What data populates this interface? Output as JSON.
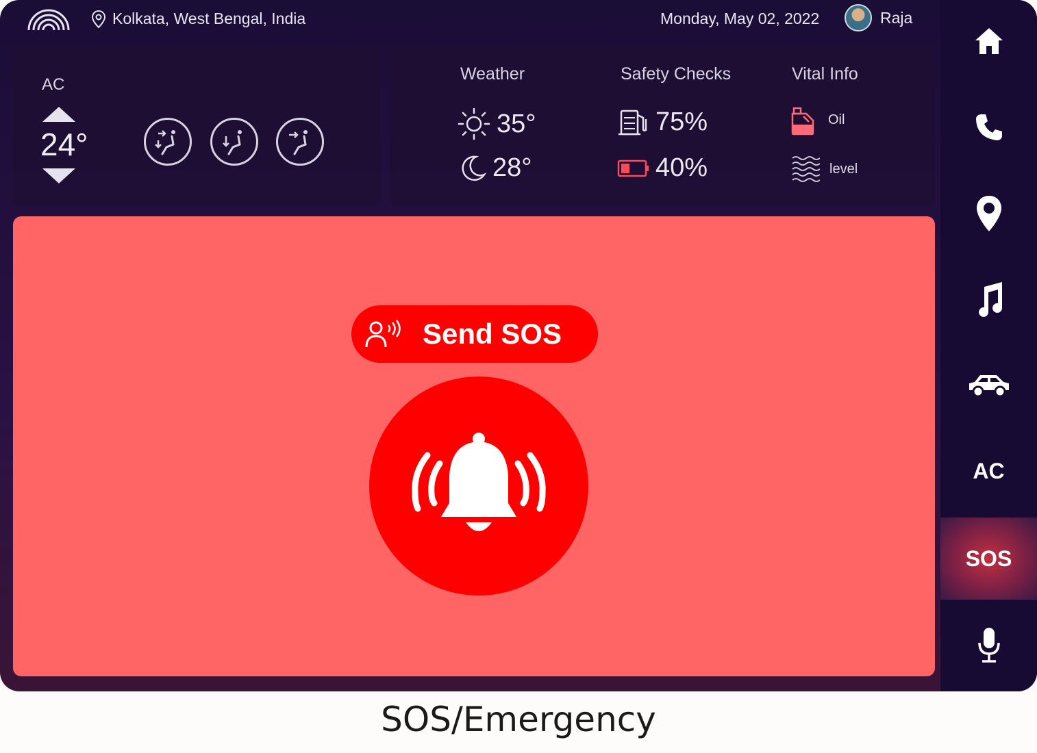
{
  "header": {
    "location": "Kolkata, West Bengal, India",
    "date": "Monday, May 02, 2022",
    "user_name": "Raja"
  },
  "ac": {
    "label": "AC",
    "temperature": "24°"
  },
  "info": {
    "weather": {
      "title": "Weather",
      "day_temp": "35°",
      "night_temp": "28°"
    },
    "safety": {
      "title": "Safety Checks",
      "fuel": "75%",
      "battery": "40%"
    },
    "vital": {
      "title": "Vital Info",
      "oil": "Oil",
      "level": "level"
    }
  },
  "sos": {
    "button_label": "Send SOS"
  },
  "sidebar": {
    "ac_label": "AC",
    "sos_label": "SOS"
  },
  "caption": "SOS/Emergency",
  "colors": {
    "accent_red": "#ff0000",
    "panel_red": "#ff6564",
    "bg": "#1a0d36"
  }
}
